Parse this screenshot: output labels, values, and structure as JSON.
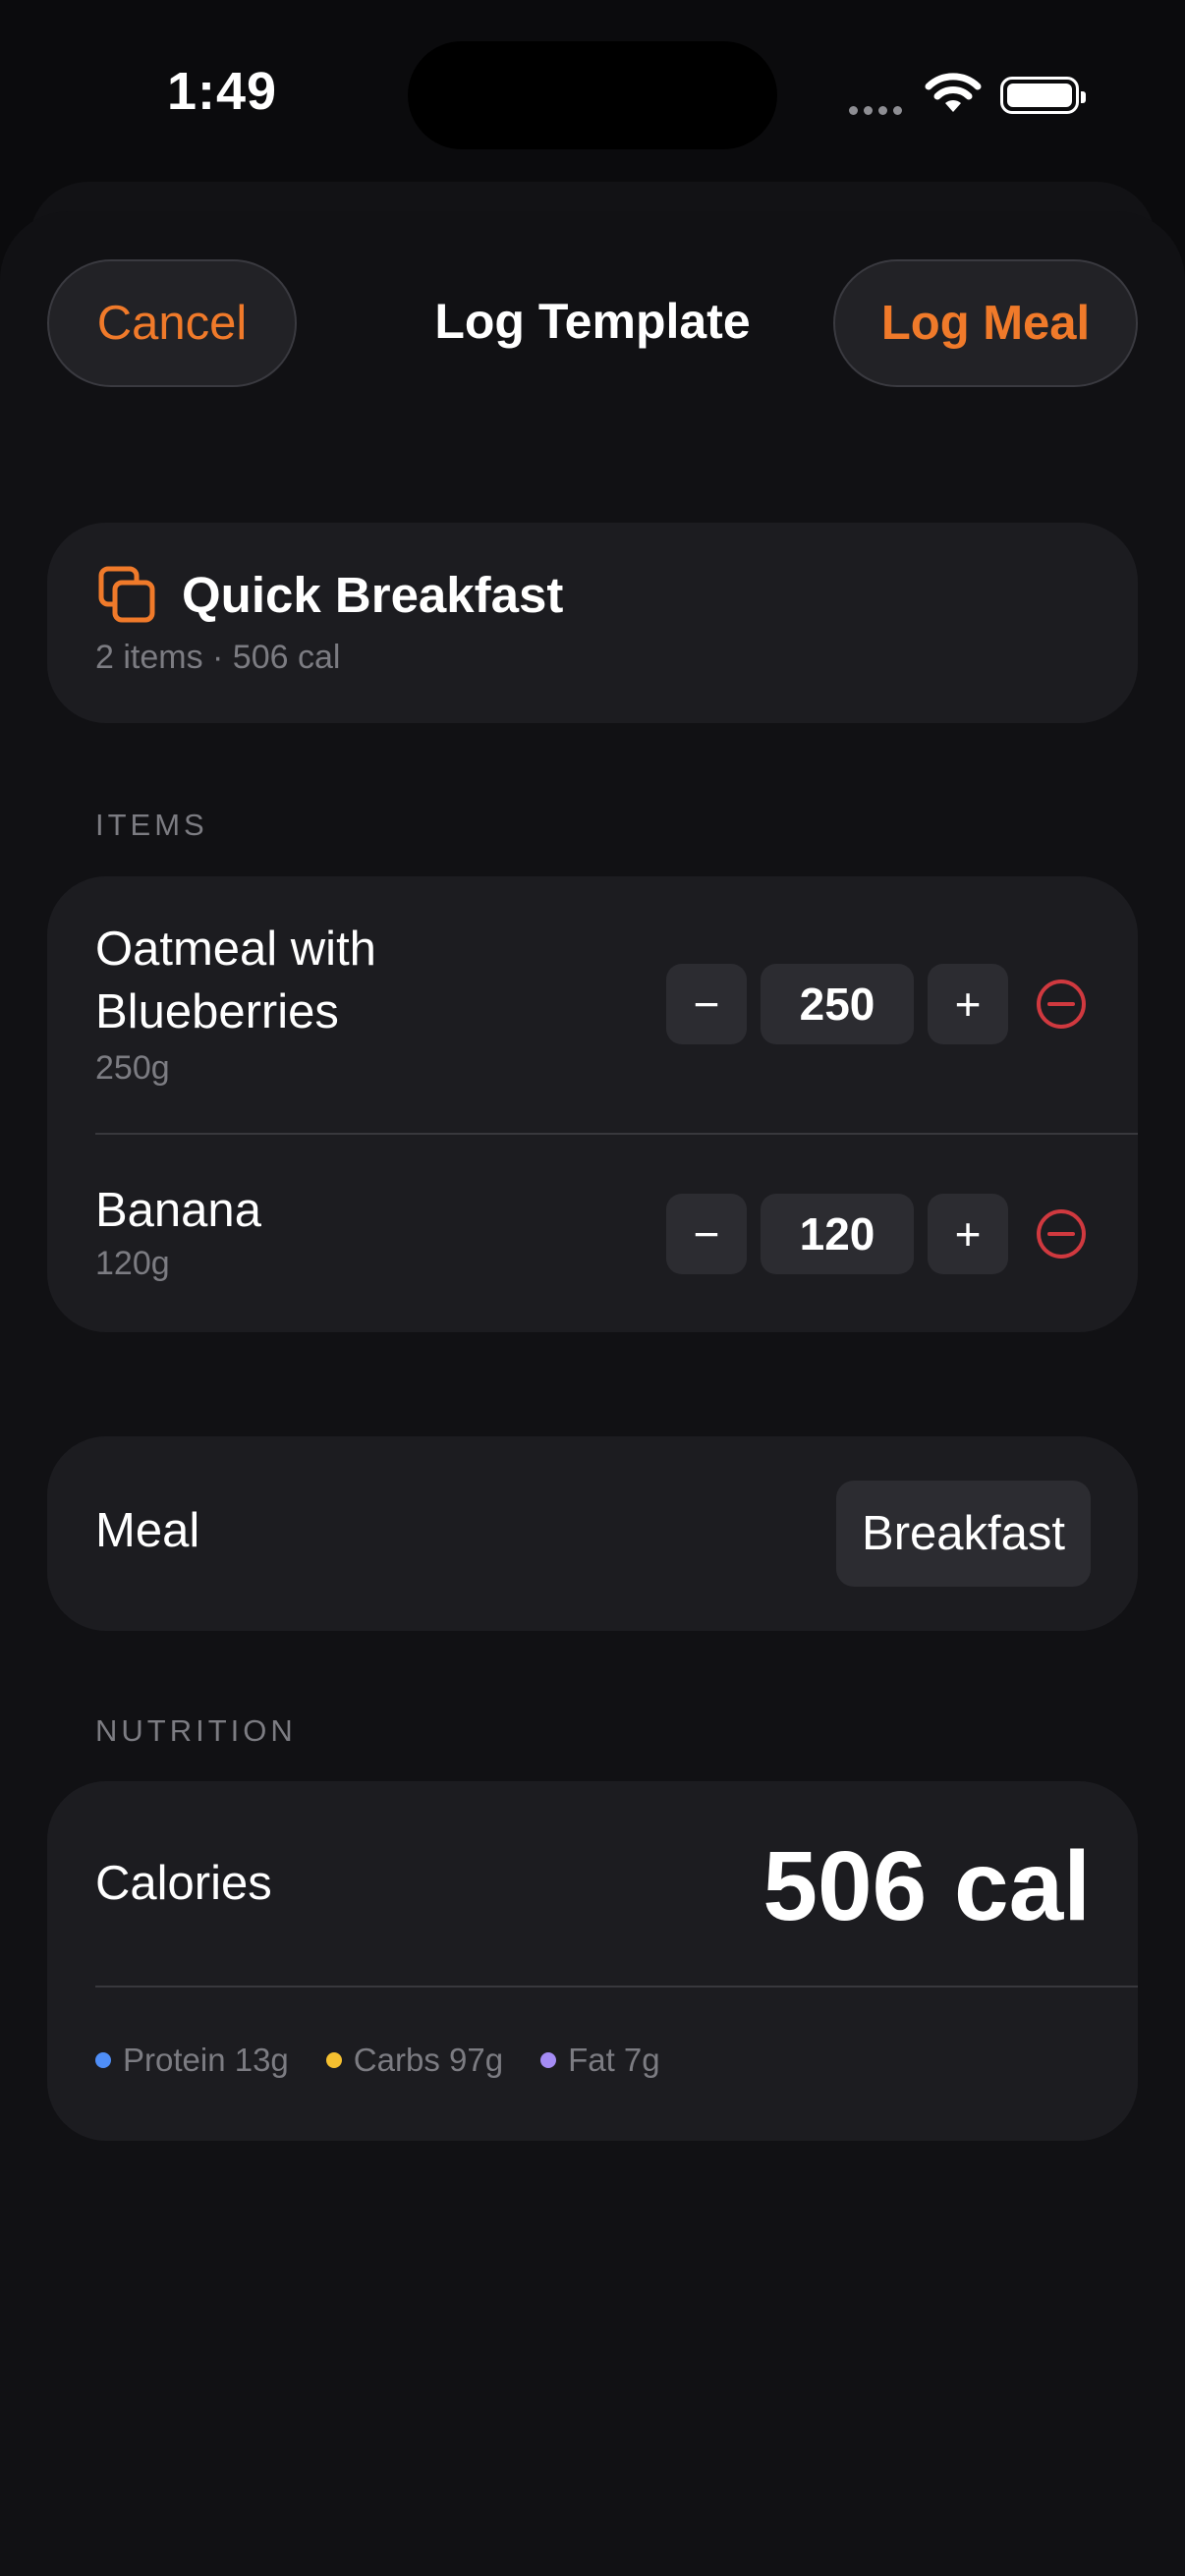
{
  "status": {
    "time": "1:49"
  },
  "header": {
    "cancel_label": "Cancel",
    "title": "Log Template",
    "log_label": "Log Meal"
  },
  "template": {
    "name": "Quick Breakfast",
    "summary": "2 items · 506 cal"
  },
  "items_section": {
    "label": "ITEMS"
  },
  "items": [
    {
      "name": "Oatmeal with Blueberries",
      "portion": "250g",
      "quantity": "250",
      "minus": "−",
      "plus": "+"
    },
    {
      "name": "Banana",
      "portion": "120g",
      "quantity": "120",
      "minus": "−",
      "plus": "+"
    }
  ],
  "meal": {
    "label": "Meal",
    "value": "Breakfast"
  },
  "nutrition_section": {
    "label": "NUTRITION"
  },
  "nutrition": {
    "calories_label": "Calories",
    "calories_value": "506 cal",
    "macros": [
      {
        "label": "Protein 13g",
        "color": "#4f8ef7"
      },
      {
        "label": "Carbs 97g",
        "color": "#f5c030"
      },
      {
        "label": "Fat 7g",
        "color": "#a58cf5"
      }
    ]
  },
  "colors": {
    "accent": "#f07a2a",
    "destructive": "#d0393f"
  }
}
